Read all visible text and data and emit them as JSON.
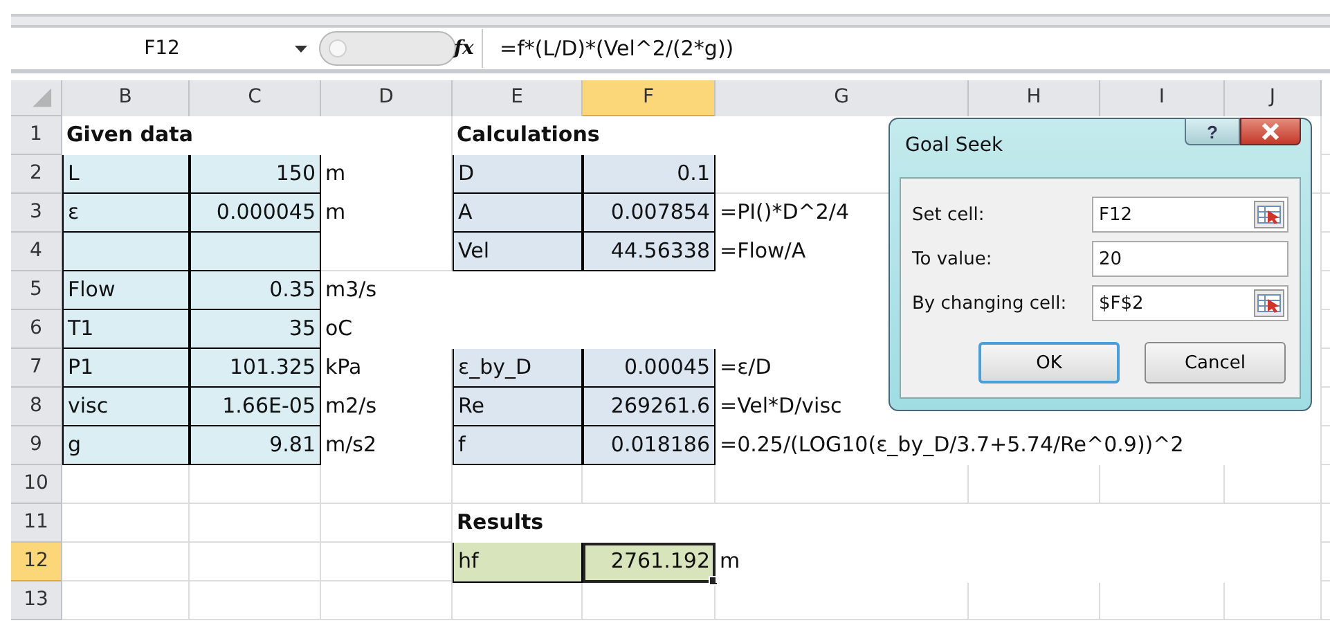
{
  "formula_bar": {
    "name_box": "F12",
    "function_label": "fx",
    "formula": "=f*(L/D)*(Vel^2/(2*g))"
  },
  "columns": [
    {
      "label": "B",
      "selected": false
    },
    {
      "label": "C",
      "selected": false
    },
    {
      "label": "D",
      "selected": false
    },
    {
      "label": "E",
      "selected": false
    },
    {
      "label": "F",
      "selected": true
    },
    {
      "label": "G",
      "selected": false
    },
    {
      "label": "H",
      "selected": false
    },
    {
      "label": "I",
      "selected": false
    },
    {
      "label": "J",
      "selected": false
    }
  ],
  "rows": [
    {
      "number": "1",
      "selected": false,
      "cells": [
        {
          "kind": "heading",
          "text": "Given data",
          "selected": false
        },
        null,
        null,
        {
          "kind": "heading",
          "text": "Calculations",
          "selected": false
        },
        null,
        null,
        null,
        null,
        null
      ]
    },
    {
      "number": "2",
      "selected": false,
      "cells": [
        {
          "kind": "input-label",
          "text": "L",
          "selected": false
        },
        {
          "kind": "input-number",
          "text": "150",
          "selected": false
        },
        {
          "kind": "label",
          "text": "m",
          "selected": false
        },
        {
          "kind": "calc-label",
          "text": "D",
          "selected": false
        },
        {
          "kind": "calc-number",
          "text": "0.1",
          "selected": false
        },
        null,
        null,
        null,
        null
      ]
    },
    {
      "number": "3",
      "selected": false,
      "cells": [
        {
          "kind": "input-label",
          "text": "ε",
          "selected": false
        },
        {
          "kind": "input-number",
          "text": "0.000045",
          "selected": false
        },
        {
          "kind": "label",
          "text": "m",
          "selected": false
        },
        {
          "kind": "calc-label",
          "text": "A",
          "selected": false
        },
        {
          "kind": "calc-number",
          "text": "0.007854",
          "selected": false
        },
        {
          "kind": "label",
          "text": "=PI()*D^2/4",
          "selected": false
        },
        null,
        null,
        null
      ]
    },
    {
      "number": "4",
      "selected": false,
      "cells": [
        {
          "kind": "input-label",
          "selected": false
        },
        {
          "kind": "input-number",
          "selected": false
        },
        null,
        {
          "kind": "calc-label",
          "text": "Vel",
          "selected": false
        },
        {
          "kind": "calc-number",
          "text": "44.56338",
          "selected": false
        },
        {
          "kind": "label",
          "text": "=Flow/A",
          "selected": false
        },
        null,
        null,
        null
      ]
    },
    {
      "number": "5",
      "selected": false,
      "cells": [
        {
          "kind": "input-label",
          "text": "Flow",
          "selected": false
        },
        {
          "kind": "input-number",
          "text": "0.35",
          "selected": false
        },
        {
          "kind": "label",
          "text": "m3/s",
          "selected": false
        },
        null,
        null,
        null,
        null,
        null,
        null
      ]
    },
    {
      "number": "6",
      "selected": false,
      "cells": [
        {
          "kind": "input-label",
          "text": "T1",
          "selected": false
        },
        {
          "kind": "input-number",
          "text": "35",
          "selected": false
        },
        {
          "kind": "label",
          "text": "oC",
          "selected": false
        },
        null,
        null,
        null,
        null,
        null,
        null
      ]
    },
    {
      "number": "7",
      "selected": false,
      "cells": [
        {
          "kind": "input-label",
          "text": "P1",
          "selected": false
        },
        {
          "kind": "input-number",
          "text": "101.325",
          "selected": false
        },
        {
          "kind": "label",
          "text": "kPa",
          "selected": false
        },
        {
          "kind": "calc-label",
          "text": "ε_by_D",
          "selected": false
        },
        {
          "kind": "calc-number",
          "text": "0.00045",
          "selected": false
        },
        {
          "kind": "label",
          "text": "=ε/D",
          "selected": false
        },
        null,
        null,
        null
      ]
    },
    {
      "number": "8",
      "selected": false,
      "cells": [
        {
          "kind": "input-label",
          "text": "visc",
          "selected": false
        },
        {
          "kind": "input-number",
          "text": "1.66E-05",
          "selected": false
        },
        {
          "kind": "label",
          "text": "m2/s",
          "selected": false
        },
        {
          "kind": "calc-label",
          "text": "Re",
          "selected": false
        },
        {
          "kind": "calc-number",
          "text": "269261.6",
          "selected": false
        },
        {
          "kind": "label",
          "text": "=Vel*D/visc",
          "selected": false
        },
        null,
        null,
        null
      ]
    },
    {
      "number": "9",
      "selected": false,
      "cells": [
        {
          "kind": "input-label",
          "text": "g",
          "selected": false
        },
        {
          "kind": "input-number",
          "text": "9.81",
          "selected": false
        },
        {
          "kind": "label",
          "text": "m/s2",
          "selected": false
        },
        {
          "kind": "calc-label",
          "text": "f",
          "selected": false
        },
        {
          "kind": "calc-number",
          "text": "0.018186",
          "selected": false
        },
        {
          "kind": "label",
          "text": "=0.25/(LOG10(ε_by_D/3.7+5.74/Re^0.9))^2",
          "selected": false
        },
        null,
        null,
        null
      ]
    },
    {
      "number": "10",
      "selected": false,
      "cells": [
        null,
        null,
        null,
        null,
        null,
        null,
        null,
        null,
        null
      ]
    },
    {
      "number": "11",
      "selected": false,
      "cells": [
        null,
        null,
        null,
        {
          "kind": "heading",
          "text": "Results",
          "selected": false
        },
        null,
        null,
        null,
        null,
        null
      ]
    },
    {
      "number": "12",
      "selected": true,
      "cells": [
        null,
        null,
        null,
        {
          "kind": "result-label",
          "text": "hf",
          "selected": false
        },
        {
          "kind": "result-number",
          "text": "2761.192",
          "selected": true
        },
        {
          "kind": "label",
          "text": "m",
          "selected": false
        },
        null,
        null,
        null
      ]
    },
    {
      "number": "13",
      "selected": false,
      "cells": [
        null,
        null,
        null,
        null,
        null,
        null,
        null,
        null,
        null
      ]
    }
  ],
  "dialog": {
    "title": "Goal Seek",
    "help": "?",
    "fields": [
      {
        "label": "Set cell:",
        "value": "F12",
        "picker": true
      },
      {
        "label": "To value:",
        "value": "20",
        "picker": false
      },
      {
        "label": "By changing cell:",
        "value": "$F$2",
        "picker": true
      }
    ],
    "buttons": [
      {
        "label": "OK",
        "default": true
      },
      {
        "label": "Cancel",
        "default": false
      }
    ]
  }
}
